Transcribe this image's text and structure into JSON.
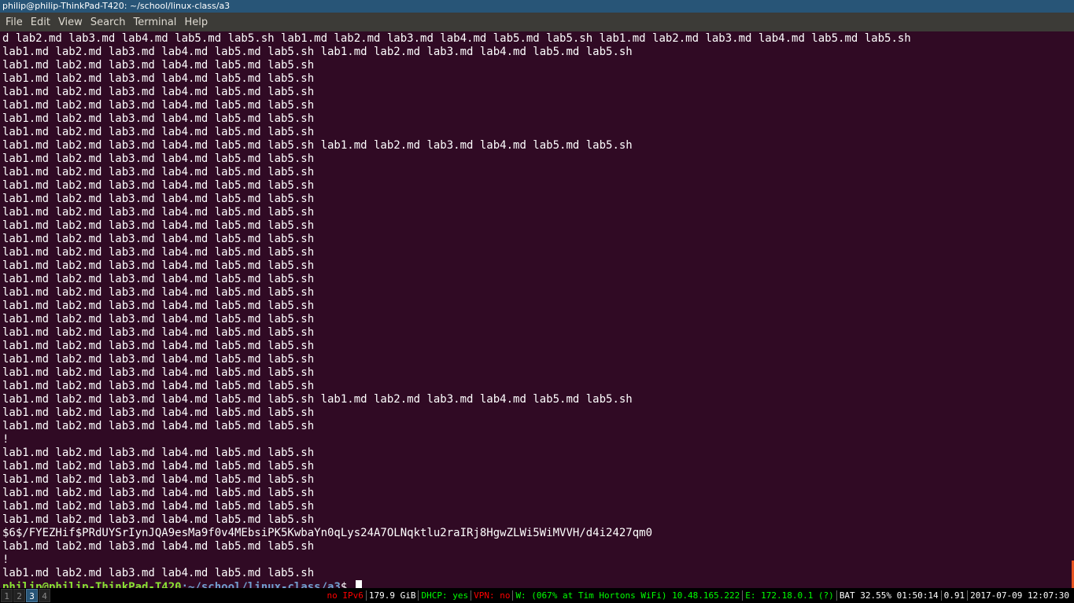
{
  "window": {
    "title": "philip@philip-ThinkPad-T420: ~/school/linux-class/a3"
  },
  "menu": {
    "items": [
      "File",
      "Edit",
      "View",
      "Search",
      "Terminal",
      "Help"
    ]
  },
  "terminal": {
    "lines": [
      "d lab2.md lab3.md lab4.md lab5.md lab5.sh lab1.md lab2.md lab3.md lab4.md lab5.md lab5.sh lab1.md lab2.md lab3.md lab4.md lab5.md lab5.sh",
      "lab1.md lab2.md lab3.md lab4.md lab5.md lab5.sh lab1.md lab2.md lab3.md lab4.md lab5.md lab5.sh",
      "lab1.md lab2.md lab3.md lab4.md lab5.md lab5.sh",
      "lab1.md lab2.md lab3.md lab4.md lab5.md lab5.sh",
      "lab1.md lab2.md lab3.md lab4.md lab5.md lab5.sh",
      "lab1.md lab2.md lab3.md lab4.md lab5.md lab5.sh",
      "lab1.md lab2.md lab3.md lab4.md lab5.md lab5.sh",
      "lab1.md lab2.md lab3.md lab4.md lab5.md lab5.sh",
      "lab1.md lab2.md lab3.md lab4.md lab5.md lab5.sh lab1.md lab2.md lab3.md lab4.md lab5.md lab5.sh",
      "lab1.md lab2.md lab3.md lab4.md lab5.md lab5.sh",
      "lab1.md lab2.md lab3.md lab4.md lab5.md lab5.sh",
      "lab1.md lab2.md lab3.md lab4.md lab5.md lab5.sh",
      "lab1.md lab2.md lab3.md lab4.md lab5.md lab5.sh",
      "lab1.md lab2.md lab3.md lab4.md lab5.md lab5.sh",
      "lab1.md lab2.md lab3.md lab4.md lab5.md lab5.sh",
      "lab1.md lab2.md lab3.md lab4.md lab5.md lab5.sh",
      "lab1.md lab2.md lab3.md lab4.md lab5.md lab5.sh",
      "lab1.md lab2.md lab3.md lab4.md lab5.md lab5.sh",
      "lab1.md lab2.md lab3.md lab4.md lab5.md lab5.sh",
      "lab1.md lab2.md lab3.md lab4.md lab5.md lab5.sh",
      "lab1.md lab2.md lab3.md lab4.md lab5.md lab5.sh",
      "lab1.md lab2.md lab3.md lab4.md lab5.md lab5.sh",
      "lab1.md lab2.md lab3.md lab4.md lab5.md lab5.sh",
      "lab1.md lab2.md lab3.md lab4.md lab5.md lab5.sh",
      "lab1.md lab2.md lab3.md lab4.md lab5.md lab5.sh",
      "lab1.md lab2.md lab3.md lab4.md lab5.md lab5.sh",
      "lab1.md lab2.md lab3.md lab4.md lab5.md lab5.sh",
      "lab1.md lab2.md lab3.md lab4.md lab5.md lab5.sh lab1.md lab2.md lab3.md lab4.md lab5.md lab5.sh",
      "lab1.md lab2.md lab3.md lab4.md lab5.md lab5.sh",
      "lab1.md lab2.md lab3.md lab4.md lab5.md lab5.sh",
      "!",
      "lab1.md lab2.md lab3.md lab4.md lab5.md lab5.sh",
      "lab1.md lab2.md lab3.md lab4.md lab5.md lab5.sh",
      "lab1.md lab2.md lab3.md lab4.md lab5.md lab5.sh",
      "lab1.md lab2.md lab3.md lab4.md lab5.md lab5.sh",
      "lab1.md lab2.md lab3.md lab4.md lab5.md lab5.sh",
      "lab1.md lab2.md lab3.md lab4.md lab5.md lab5.sh",
      "$6$/FYEZHif$PRdUYSrIynJQA9esMa9f0v4MEbsiPK5KwbaYn0qLys24A7OLNqktlu2raIRj8HgwZLWi5WiMVVH/d4i2427qm0",
      "lab1.md lab2.md lab3.md lab4.md lab5.md lab5.sh",
      "!",
      "lab1.md lab2.md lab3.md lab4.md lab5.md lab5.sh"
    ],
    "prompt": {
      "user_host": "philip@philip-ThinkPad-T420",
      "path": ":~/school/linux-class/a3",
      "symbol": "$ "
    }
  },
  "statusbar": {
    "workspaces": [
      "1",
      "2",
      "3",
      "4"
    ],
    "active_workspace": "3",
    "ipv6": "no IPv6",
    "disk": "179.9 GiB",
    "dhcp": "DHCP: yes",
    "vpn": "VPN: no",
    "wifi": "W: (067% at Tim Hortons WiFi) 10.48.165.222",
    "ethernet": "E: 172.18.0.1 (?)",
    "battery": "BAT 32.55% 01:50:14",
    "load": "0.91",
    "datetime": "2017-07-09 12:07:30"
  },
  "colors": {
    "terminal_bg": "#300a24",
    "prompt_user": "#8ae234",
    "prompt_path": "#729fcf",
    "titlebar_bg": "#285577",
    "status_red": "#ff0000",
    "status_green": "#00ff00"
  }
}
